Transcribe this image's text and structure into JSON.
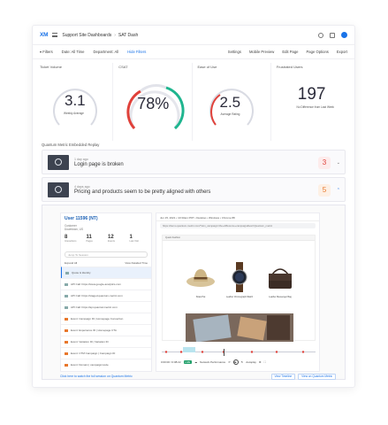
{
  "app": {
    "logo": "XM",
    "breadcrumb": "Support Site Dashboards",
    "dashboard": "SAT Dash"
  },
  "filters": {
    "label": "Filters",
    "items": [
      "Date: All Time",
      "Department: All",
      "Hide Filters"
    ],
    "actions": [
      "Settings",
      "Mobile Preview",
      "Edit Page",
      "Page Options",
      "Export"
    ]
  },
  "widgets": [
    {
      "title": "Ticket Volume",
      "value": "3.1",
      "caption": "Weekly Average"
    },
    {
      "title": "CSAT",
      "value": "78%",
      "progress": 78
    },
    {
      "title": "Ease of Use",
      "value": "2.5",
      "caption": "Average Rating"
    },
    {
      "title": "Frustrated Users",
      "value": "197",
      "caption": "No Difference from Last Week"
    }
  ],
  "section": {
    "title": "Quantum Metric Embedded Replay"
  },
  "cards": [
    {
      "ago": "1 day ago",
      "text": "Login page is broken",
      "score": "3",
      "score_color": "#e0413a"
    },
    {
      "ago": "4 days ago",
      "text": "Pricing and products seem to be pretty aligned with others",
      "score": "5",
      "score_color": "#e8772c"
    }
  ],
  "session": {
    "user": "User 11596 (NT)",
    "meta": [
      "Customer",
      "Downtown, US"
    ],
    "stats": [
      {
        "value": "8",
        "label": "Interactions"
      },
      {
        "value": "11",
        "label": "Pages"
      },
      {
        "value": "12",
        "label": "Events"
      },
      {
        "value": "1",
        "label": "Last Visit"
      }
    ],
    "search_placeholder": "Jump To Session",
    "expand_all": "Expand All",
    "view_detailed": "View Detailed Time",
    "events": [
      "Quote & Identity",
      "API Call: https://www.google-analytics.com",
      "API Call: https://staged.quantum-metric.com",
      "API Call: https://api.quantummetric.com",
      "Event: Campaign ID | Homepage Convertion",
      "Event: Experience ID | Homepage CTA",
      "Event: Variation ID | Variation ID",
      "Event: CTM Campaign | Campaign ID",
      "Event: Domain | campaignmode"
    ]
  },
  "replay": {
    "session_info": "Jun 15, 2021 • 10:33am PDT • Desktop • Windows • Chrome 88",
    "url": "https://demo.quantum-metric.com/?utm_campaign=the+difference+campaign&test=Quantum_metric",
    "shop_tab": "Quant Fashion",
    "products": [
      "Straw Hat",
      "Leather Chronograph Watch",
      "Leather Messenger Bag"
    ],
    "time": "0:00:00 / 0:08:22",
    "live_label": "LIVE",
    "network_label": "Network Performance",
    "autoplay": "Autoplay"
  },
  "footer": {
    "link": "Click here to watch the full session on Quantum Metric",
    "buttons": [
      "View Timeline",
      "View on Quantum Metric"
    ]
  }
}
